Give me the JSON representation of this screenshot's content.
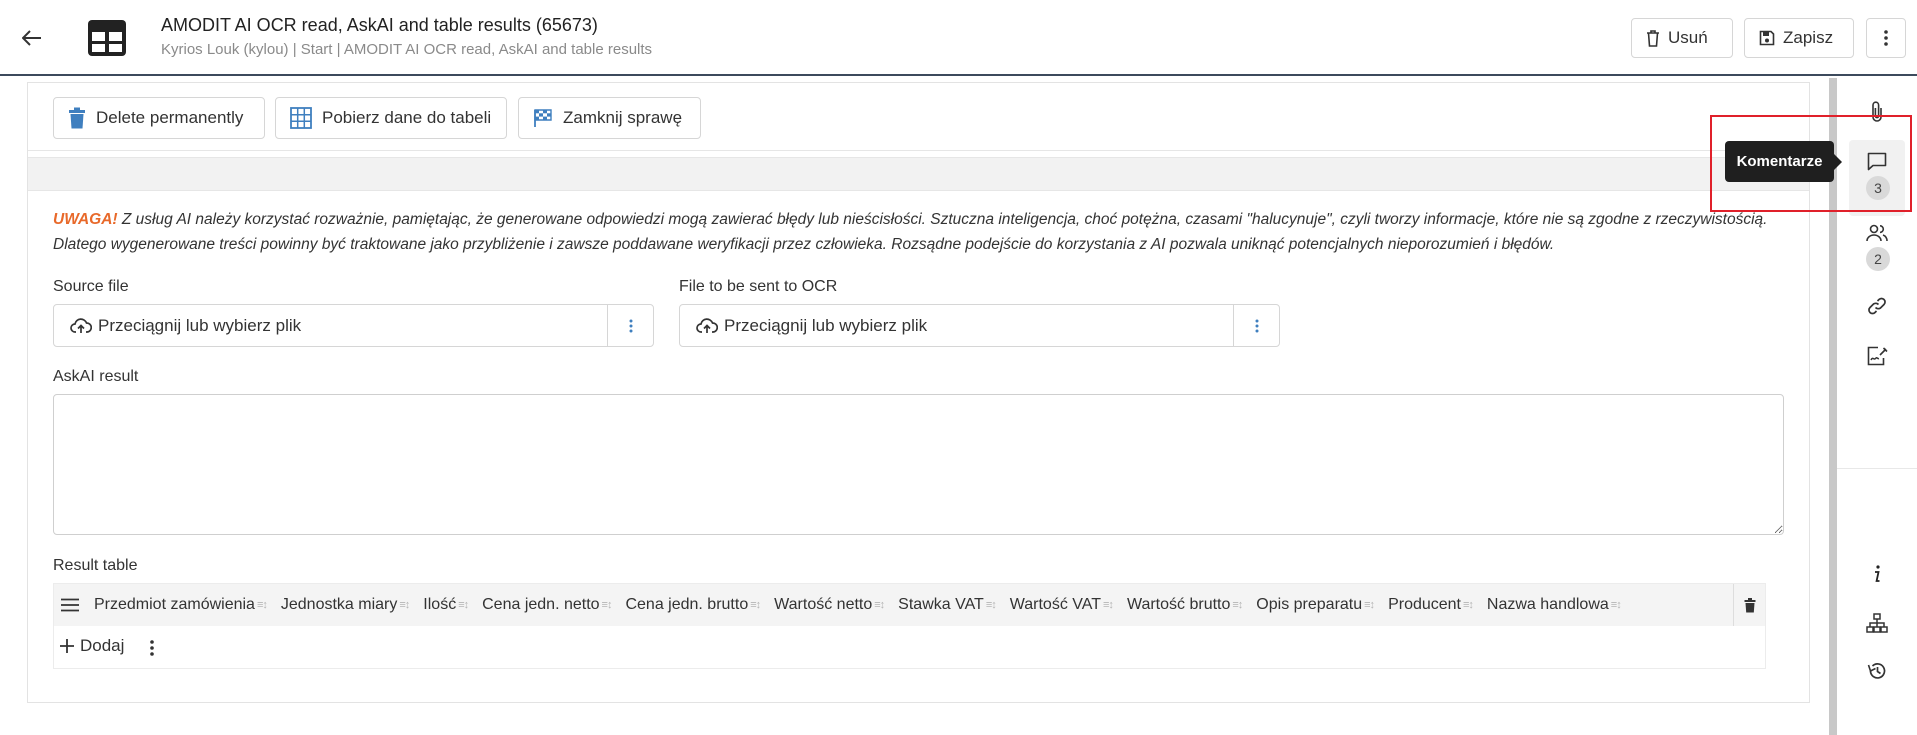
{
  "header": {
    "title": "AMODIT AI OCR read, AskAI and table results (65673)",
    "subtitle": "Kyrios Louk (kylou) | Start | AMODIT AI OCR read, AskAI and table results",
    "delete_label": "Usuń",
    "save_label": "Zapisz"
  },
  "toolbar": {
    "delete_permanently": "Delete permanently",
    "fetch_table": "Pobierz dane do tabeli",
    "close_case": "Zamknij sprawę"
  },
  "warning": {
    "label": "UWAGA!",
    "text": " Z usług AI należy korzystać rozważnie, pamiętając, że generowane odpowiedzi mogą zawierać błędy lub nieścisłości. Sztuczna inteligencja, choć potężna, czasami \"halucynuje\", czyli tworzy informacje, które nie są zgodne z rzeczywistością. Dlatego wygenerowane treści powinny być traktowane jako przybliżenie i zawsze poddawane weryfikacji przez człowieka. Rozsądne podejście do korzystania z AI pozwala uniknąć potencjalnych nieporozumień i błędów."
  },
  "fields": {
    "source_file_label": "Source file",
    "ocr_file_label": "File to be sent to OCR",
    "drop_text": "Przeciągnij lub wybierz plik",
    "askai_label": "AskAI result",
    "askai_value": "",
    "result_table_label": "Result table"
  },
  "table": {
    "columns": [
      "Przedmiot zamówienia",
      "Jednostka miary",
      "Ilość",
      "Cena jedn. netto",
      "Cena jedn. brutto",
      "Wartość netto",
      "Stawka VAT",
      "Wartość VAT",
      "Wartość brutto",
      "Opis preparatu",
      "Producent",
      "Nazwa handlowa"
    ],
    "add_label": "Dodaj"
  },
  "sidebar": {
    "comments_count": "3",
    "participants_count": "2",
    "tooltip": "Komentarze"
  },
  "colors": {
    "warning_orange": "#e8692a",
    "highlight_red": "#e0202a",
    "header_border": "#3c4a5c",
    "delete_icon": "#3f7fbf"
  }
}
